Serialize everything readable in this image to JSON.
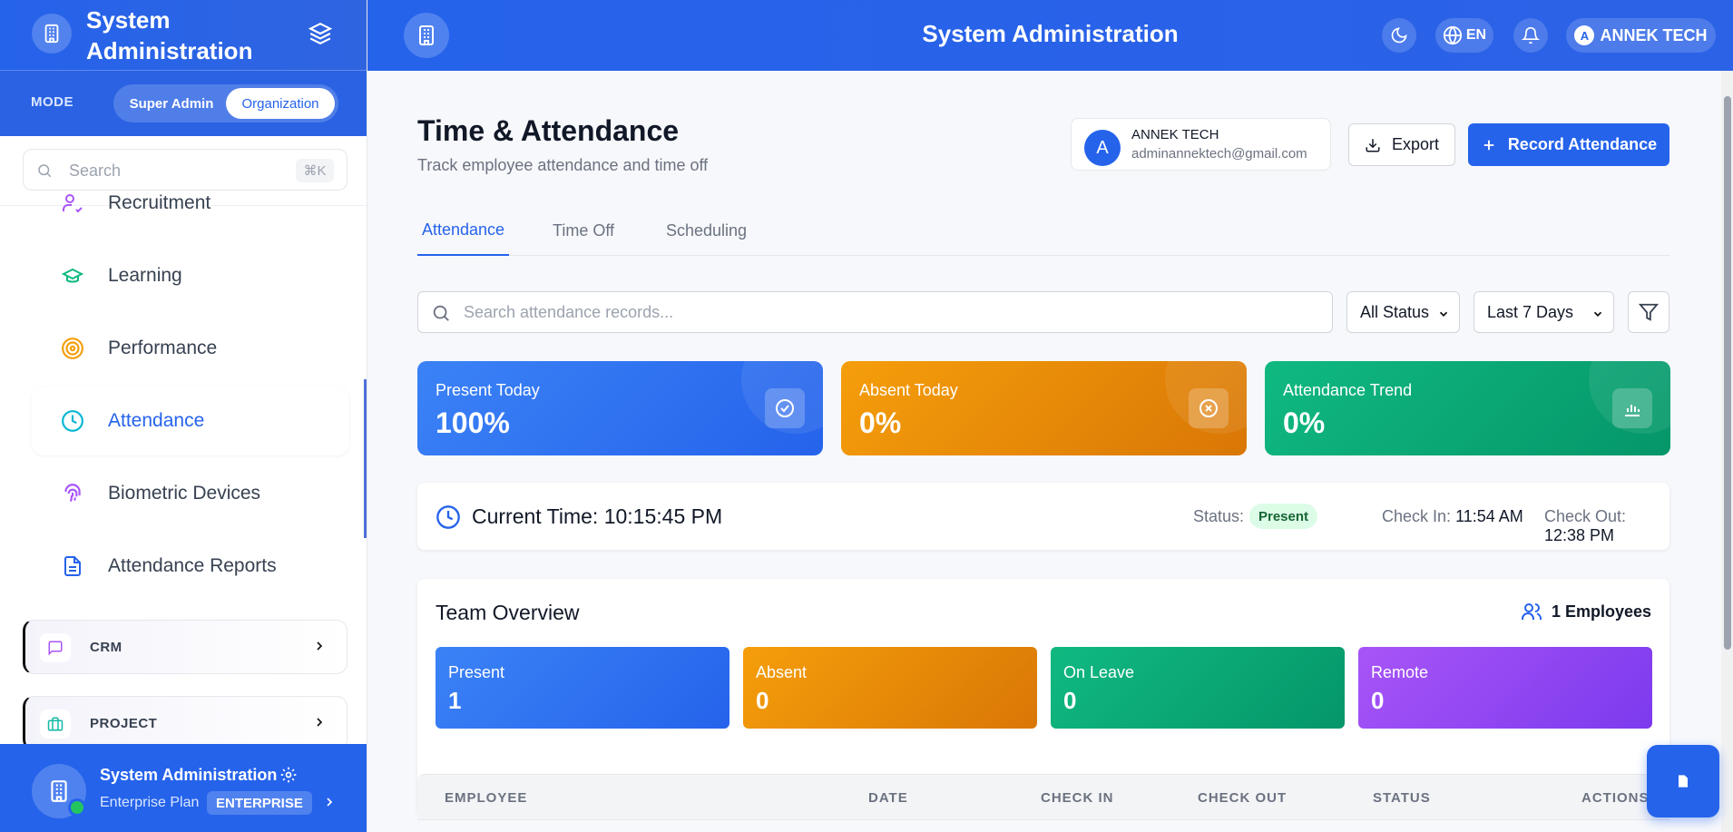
{
  "sidebar": {
    "app_title_line1": "System",
    "app_title_line2": "Administration",
    "mode_label": "MODE",
    "mode_options": [
      "Super Admin",
      "Organization"
    ],
    "mode_selected": "Organization",
    "search_placeholder": "Search",
    "search_shortcut": "⌘K",
    "items": [
      {
        "label": "Recruitment",
        "icon": "recruitment-icon"
      },
      {
        "label": "Learning",
        "icon": "graduation-cap-icon"
      },
      {
        "label": "Performance",
        "icon": "target-icon"
      },
      {
        "label": "Attendance",
        "icon": "clock-icon",
        "active": true
      },
      {
        "label": "Biometric Devices",
        "icon": "fingerprint-icon"
      },
      {
        "label": "Attendance Reports",
        "icon": "document-icon"
      }
    ],
    "groups": [
      {
        "label": "CRM",
        "icon": "message-icon"
      },
      {
        "label": "PROJECT",
        "icon": "briefcase-icon"
      }
    ],
    "footer": {
      "name": "System Administration",
      "plan": "Enterprise Plan",
      "badge": "ENTERPRISE"
    }
  },
  "topbar": {
    "title": "System Administration",
    "language": "EN",
    "user": "ANNEK TECH",
    "user_initial": "A"
  },
  "page": {
    "title": "Time & Attendance",
    "subtitle": "Track employee attendance and time off",
    "user_card": {
      "initial": "A",
      "name": "ANNEK TECH",
      "email": "adminannektech@gmail.com"
    },
    "export_label": "Export",
    "record_label": "Record Attendance"
  },
  "tabs": [
    {
      "label": "Attendance",
      "active": true
    },
    {
      "label": "Time Off"
    },
    {
      "label": "Scheduling"
    }
  ],
  "filters": {
    "search_placeholder": "Search attendance records...",
    "status_selected": "All Status",
    "range_selected": "Last 7 Days"
  },
  "stats": [
    {
      "label": "Present Today",
      "value": "100%",
      "icon": "check-circle-icon",
      "color": "#3b82f6"
    },
    {
      "label": "Absent Today",
      "value": "0%",
      "icon": "x-circle-icon",
      "color": "#f59e0b"
    },
    {
      "label": "Attendance Trend",
      "value": "0%",
      "icon": "bar-chart-icon",
      "color": "#10b981"
    }
  ],
  "clock": {
    "current_time": "Current Time: 10:15:45 PM",
    "status_label": "Status:",
    "status_value": "Present",
    "check_in_label": "Check In:",
    "check_in_value": "11:54 AM",
    "check_out_label": "Check Out:",
    "check_out_value": "12:38 PM"
  },
  "team": {
    "title": "Team Overview",
    "employees": "1 Employees",
    "cards": [
      {
        "label": "Present",
        "value": "1"
      },
      {
        "label": "Absent",
        "value": "0"
      },
      {
        "label": "On Leave",
        "value": "0"
      },
      {
        "label": "Remote",
        "value": "0"
      }
    ]
  },
  "table": {
    "columns": [
      "EMPLOYEE",
      "DATE",
      "CHECK IN",
      "CHECK OUT",
      "STATUS",
      "ACTIONS"
    ]
  },
  "colors": {
    "primary": "#2563eb",
    "orange": "#f59e0b",
    "green": "#10b981",
    "purple": "#7c3aed"
  }
}
